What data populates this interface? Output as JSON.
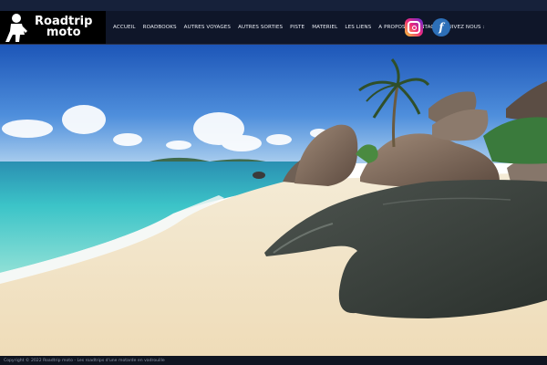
{
  "header": {
    "logo_line1": "Roadtrip",
    "logo_line2": "moto",
    "menu": [
      {
        "label": "ACCUEIL"
      },
      {
        "label": "ROADBOOKS"
      },
      {
        "label": "AUTRES VOYAGES"
      },
      {
        "label": "AUTRES SORTIES"
      },
      {
        "label": "PISTE"
      },
      {
        "label": "MATERIEL"
      },
      {
        "label": "LES LIENS"
      },
      {
        "label": "A PROPOS"
      },
      {
        "label": "CONTACT"
      },
      {
        "label": "SUIVEZ NOUS :"
      }
    ],
    "social": [
      {
        "icon": "instagram-icon"
      },
      {
        "icon": "facebook-icon",
        "glyph": "f"
      }
    ]
  },
  "footer": {
    "text": "Copyright © 2022 Roadtrip moto - Les roadtrips d'une motarde en vadrouille"
  },
  "colors": {
    "nav_bg": "#0f1629",
    "logo_bg": "#000000",
    "facebook": "#2d6fb8"
  }
}
